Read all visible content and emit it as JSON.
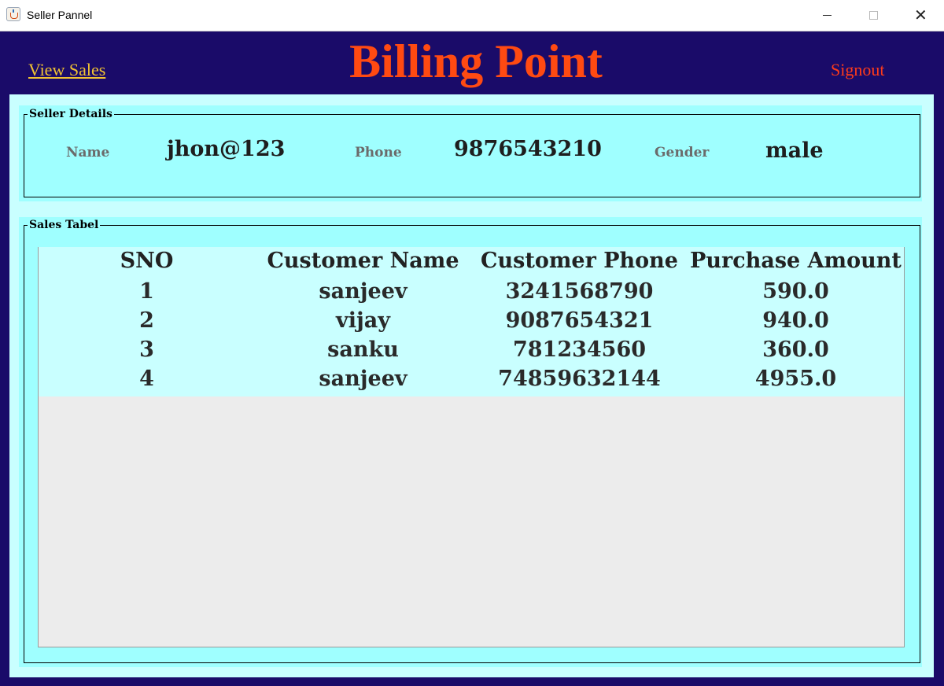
{
  "window": {
    "title": "Seller Pannel",
    "controls": {
      "minimize": "–",
      "maximize": "□",
      "close": "✕"
    }
  },
  "header": {
    "view_sales_label": "View Sales",
    "app_title": "Billing Point",
    "signout_label": "Signout"
  },
  "seller_details": {
    "legend": "Seller Details",
    "name_label": "Name",
    "name_value": "jhon@123",
    "phone_label": "Phone",
    "phone_value": "9876543210",
    "gender_label": "Gender",
    "gender_value": "male"
  },
  "sales_table": {
    "legend": "Sales Tabel",
    "columns": [
      "SNO",
      "Customer Name",
      "Customer Phone",
      "Purchase Amount"
    ],
    "rows": [
      [
        "1",
        "sanjeev",
        "3241568790",
        "590.0"
      ],
      [
        "2",
        "vijay",
        "9087654321",
        "940.0"
      ],
      [
        "3",
        "sanku",
        "781234560",
        "360.0"
      ],
      [
        "4",
        "sanjeev",
        "74859632144",
        "4955.0"
      ]
    ]
  },
  "colors": {
    "header_bg": "#1a0b69",
    "title_color": "#ff4a12",
    "view_sales_color": "#f1c232",
    "signout_color": "#ff3b1a",
    "panel_bg": "#c9ffff",
    "group_bg": "#9fffff"
  },
  "icons": {
    "app": "java-cup-icon",
    "minimize": "minimize-icon",
    "maximize": "maximize-icon",
    "close": "close-icon"
  }
}
